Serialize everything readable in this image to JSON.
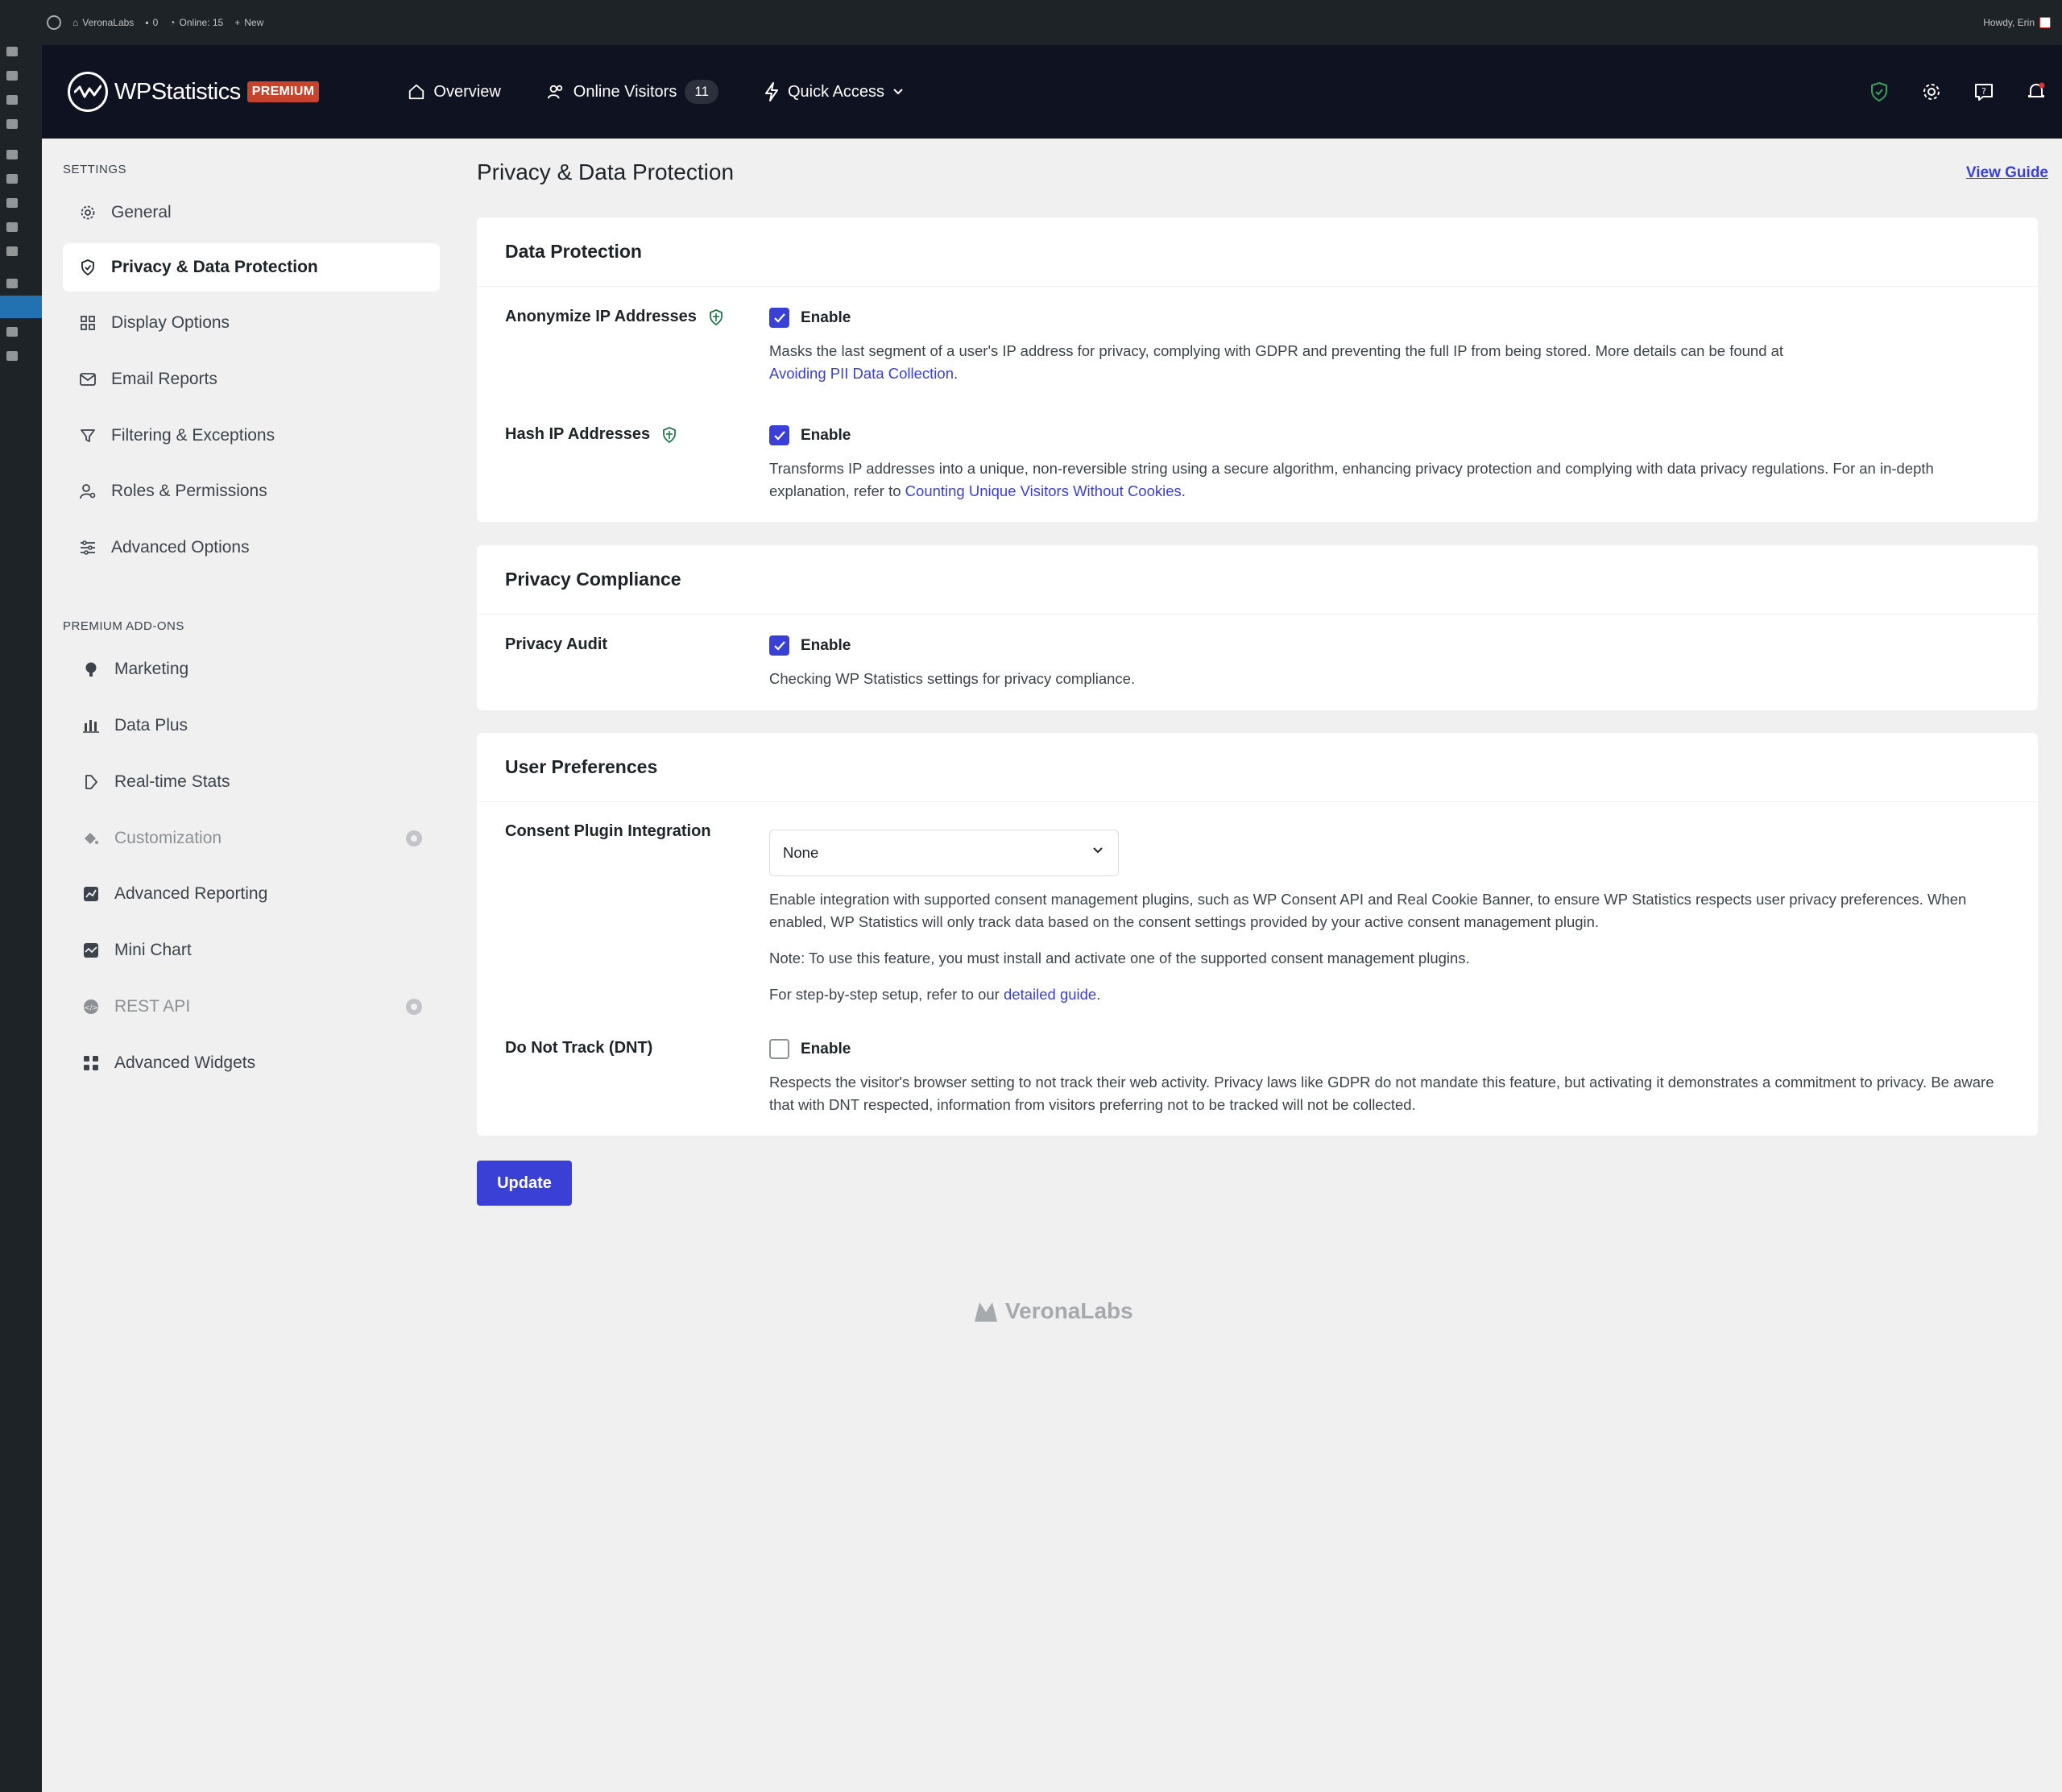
{
  "adminbar": {
    "site_name": "VeronaLabs",
    "comments_count": "0",
    "online": "Online: 15",
    "new_label": "New",
    "howdy": "Howdy, Erin"
  },
  "header": {
    "logo_text": "WPStatistics",
    "premium_badge": "PREMIUM",
    "nav": {
      "overview": "Overview",
      "online_visitors": "Online Visitors",
      "online_visitors_count": "11",
      "quick_access": "Quick Access"
    }
  },
  "sidebar": {
    "settings_heading": "SETTINGS",
    "settings_items": [
      {
        "label": "General"
      },
      {
        "label": "Privacy & Data Protection"
      },
      {
        "label": "Display Options"
      },
      {
        "label": "Email Reports"
      },
      {
        "label": "Filtering & Exceptions"
      },
      {
        "label": "Roles & Permissions"
      },
      {
        "label": "Advanced Options"
      }
    ],
    "addons_heading": "PREMIUM ADD-ONS",
    "addon_items": [
      {
        "label": "Marketing"
      },
      {
        "label": "Data Plus"
      },
      {
        "label": "Real-time Stats"
      },
      {
        "label": "Customization"
      },
      {
        "label": "Advanced Reporting"
      },
      {
        "label": "Mini Chart"
      },
      {
        "label": "REST API"
      },
      {
        "label": "Advanced Widgets"
      }
    ]
  },
  "main": {
    "page_title": "Privacy & Data Protection",
    "view_guide": "View Guide",
    "data_protection": {
      "title": "Data Protection",
      "anonymize": {
        "label": "Anonymize IP Addresses",
        "enable": "Enable",
        "checked": true,
        "desc": "Masks the last segment of a user's IP address for privacy, complying with GDPR and preventing the full IP from being stored. More details can be found at",
        "link": "Avoiding PII Data Collection"
      },
      "hash": {
        "label": "Hash IP Addresses",
        "enable": "Enable",
        "checked": true,
        "desc": "Transforms IP addresses into a unique, non-reversible string using a secure algorithm, enhancing privacy protection and complying with data privacy regulations. For an in-depth explanation, refer to",
        "link": "Counting Unique Visitors Without Cookies"
      }
    },
    "privacy_compliance": {
      "title": "Privacy Compliance",
      "audit": {
        "label": "Privacy Audit",
        "enable": "Enable",
        "checked": true,
        "desc": "Checking WP Statistics settings for privacy compliance."
      }
    },
    "user_preferences": {
      "title": "User Preferences",
      "consent": {
        "label": "Consent Plugin Integration",
        "selected": "None",
        "desc1": "Enable integration with supported consent management plugins, such as WP Consent API and Real Cookie Banner, to ensure WP Statistics respects user privacy preferences. When enabled, WP Statistics will only track data based on the consent settings provided by your active consent management plugin.",
        "desc2": "Note: To use this feature, you must install and activate one of the supported consent management plugins.",
        "desc3": "For step-by-step setup, refer to our",
        "link": "detailed guide"
      },
      "dnt": {
        "label": "Do Not Track (DNT)",
        "enable": "Enable",
        "checked": false,
        "desc": "Respects the visitor's browser setting to not track their web activity. Privacy laws like GDPR do not mandate this feature, but activating it demonstrates a commitment to privacy. Be aware that with DNT respected, information from visitors preferring not to be tracked will not be collected."
      }
    },
    "update_button": "Update"
  },
  "footer": {
    "brand": "VeronaLabs"
  },
  "colors": {
    "accent": "#3a3fd6",
    "header_bg": "#0f1220",
    "premium": "#c6432c",
    "shield": "#1f7a4a"
  }
}
